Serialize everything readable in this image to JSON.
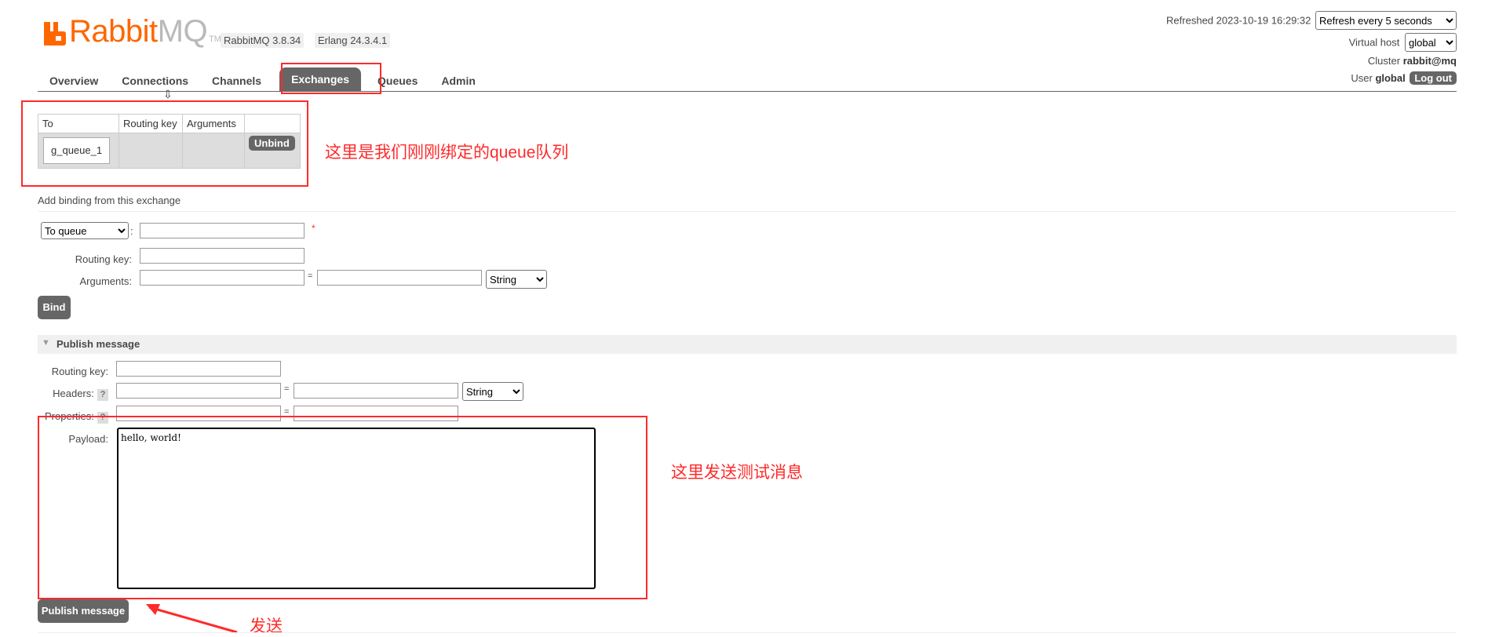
{
  "header": {
    "logo_rabbit": "Rabbit",
    "logo_mq": "MQ",
    "logo_tm": "TM",
    "rabbitmq_version": "RabbitMQ 3.8.34",
    "erlang_version": "Erlang 24.3.4.1",
    "refreshed_label": "Refreshed",
    "refreshed_value": "2023-10-19 16:29:32",
    "refresh_select": "Refresh every 5 seconds",
    "vhost_label": "Virtual host",
    "vhost_select": "global",
    "cluster_label": "Cluster",
    "cluster_value": "rabbit@mq",
    "user_label": "User",
    "user_value": "global",
    "logout": "Log out"
  },
  "nav": {
    "tabs": [
      {
        "label": "Overview"
      },
      {
        "label": "Connections"
      },
      {
        "label": "Channels"
      },
      {
        "label": "Exchanges",
        "active": true
      },
      {
        "label": "Queues"
      },
      {
        "label": "Admin"
      }
    ]
  },
  "bindings": {
    "arrow": "⇩",
    "columns": [
      "To",
      "Routing key",
      "Arguments",
      ""
    ],
    "rows": [
      {
        "to": "g_queue_1",
        "routing_key": "",
        "arguments": "",
        "action": "Unbind"
      }
    ]
  },
  "annotations": {
    "binding_note": "这里是我们刚刚绑定的queue队列",
    "send_test_note": "这里发送测试消息",
    "send_note": "发送"
  },
  "add_binding": {
    "title": "Add binding from this exchange",
    "destination_type": "To queue",
    "destination_value": "",
    "required_mark": "*",
    "routing_key_label": "Routing key:",
    "arguments_label": "Arguments:",
    "equals": "=",
    "arg_type": "String",
    "bind_button": "Bind"
  },
  "publish": {
    "title": "Publish message",
    "routing_key_label": "Routing key:",
    "headers_label": "Headers:",
    "properties_label": "Properties:",
    "help": "?",
    "equals": "=",
    "header_type": "String",
    "payload_label": "Payload:",
    "payload_value": "hello, world! ",
    "publish_button": "Publish message"
  },
  "colors": {
    "brand_orange": "#ff6600",
    "annotation_red": "#ff2a2a",
    "tab_active": "#666666"
  }
}
